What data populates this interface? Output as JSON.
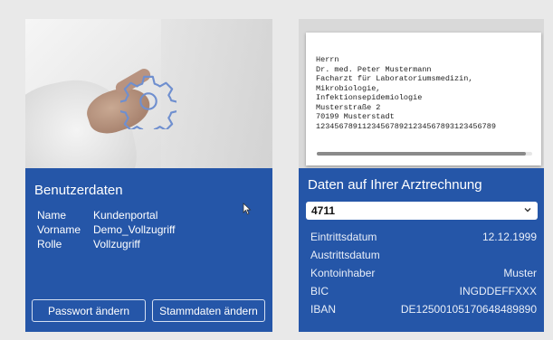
{
  "left_card": {
    "panel_title": "Benutzerdaten",
    "fields": [
      {
        "label": "Name",
        "value": "Kundenportal"
      },
      {
        "label": "Vorname",
        "value": "Demo_Vollzugriff"
      },
      {
        "label": "Rolle",
        "value": "Vollzugriff"
      }
    ],
    "buttons": {
      "password": "Passwort ändern",
      "master_data": "Stammdaten ändern"
    }
  },
  "right_card": {
    "letter_lines": [
      "Herrn",
      "Dr. med. Peter Mustermann",
      "Facharzt für Laboratoriumsmedizin,",
      "Mikrobiologie,",
      "Infektionsepidemiologie",
      "Musterstraße 2",
      "70199 Musterstadt",
      "123456789112345678921234567893123456789"
    ],
    "panel_title": "Daten auf Ihrer Arztrechnung",
    "select_value": "4711",
    "rows": [
      {
        "label": "Eintrittsdatum",
        "value": "12.12.1999"
      },
      {
        "label": "Austrittsdatum",
        "value": ""
      },
      {
        "label": "Kontoinhaber",
        "value": "Muster"
      },
      {
        "label": "BIC",
        "value": "INGDDEFFXXX"
      },
      {
        "label": "IBAN",
        "value": "DE12500105170648489890"
      }
    ],
    "scroll_position": 0.97
  },
  "colors": {
    "panel_blue": "#2556a8",
    "page_background": "#e9e9e9"
  },
  "icons": {
    "gear": "gear-icon",
    "cursor": "mouse-cursor-icon",
    "chevron": "chevron-down-icon"
  }
}
